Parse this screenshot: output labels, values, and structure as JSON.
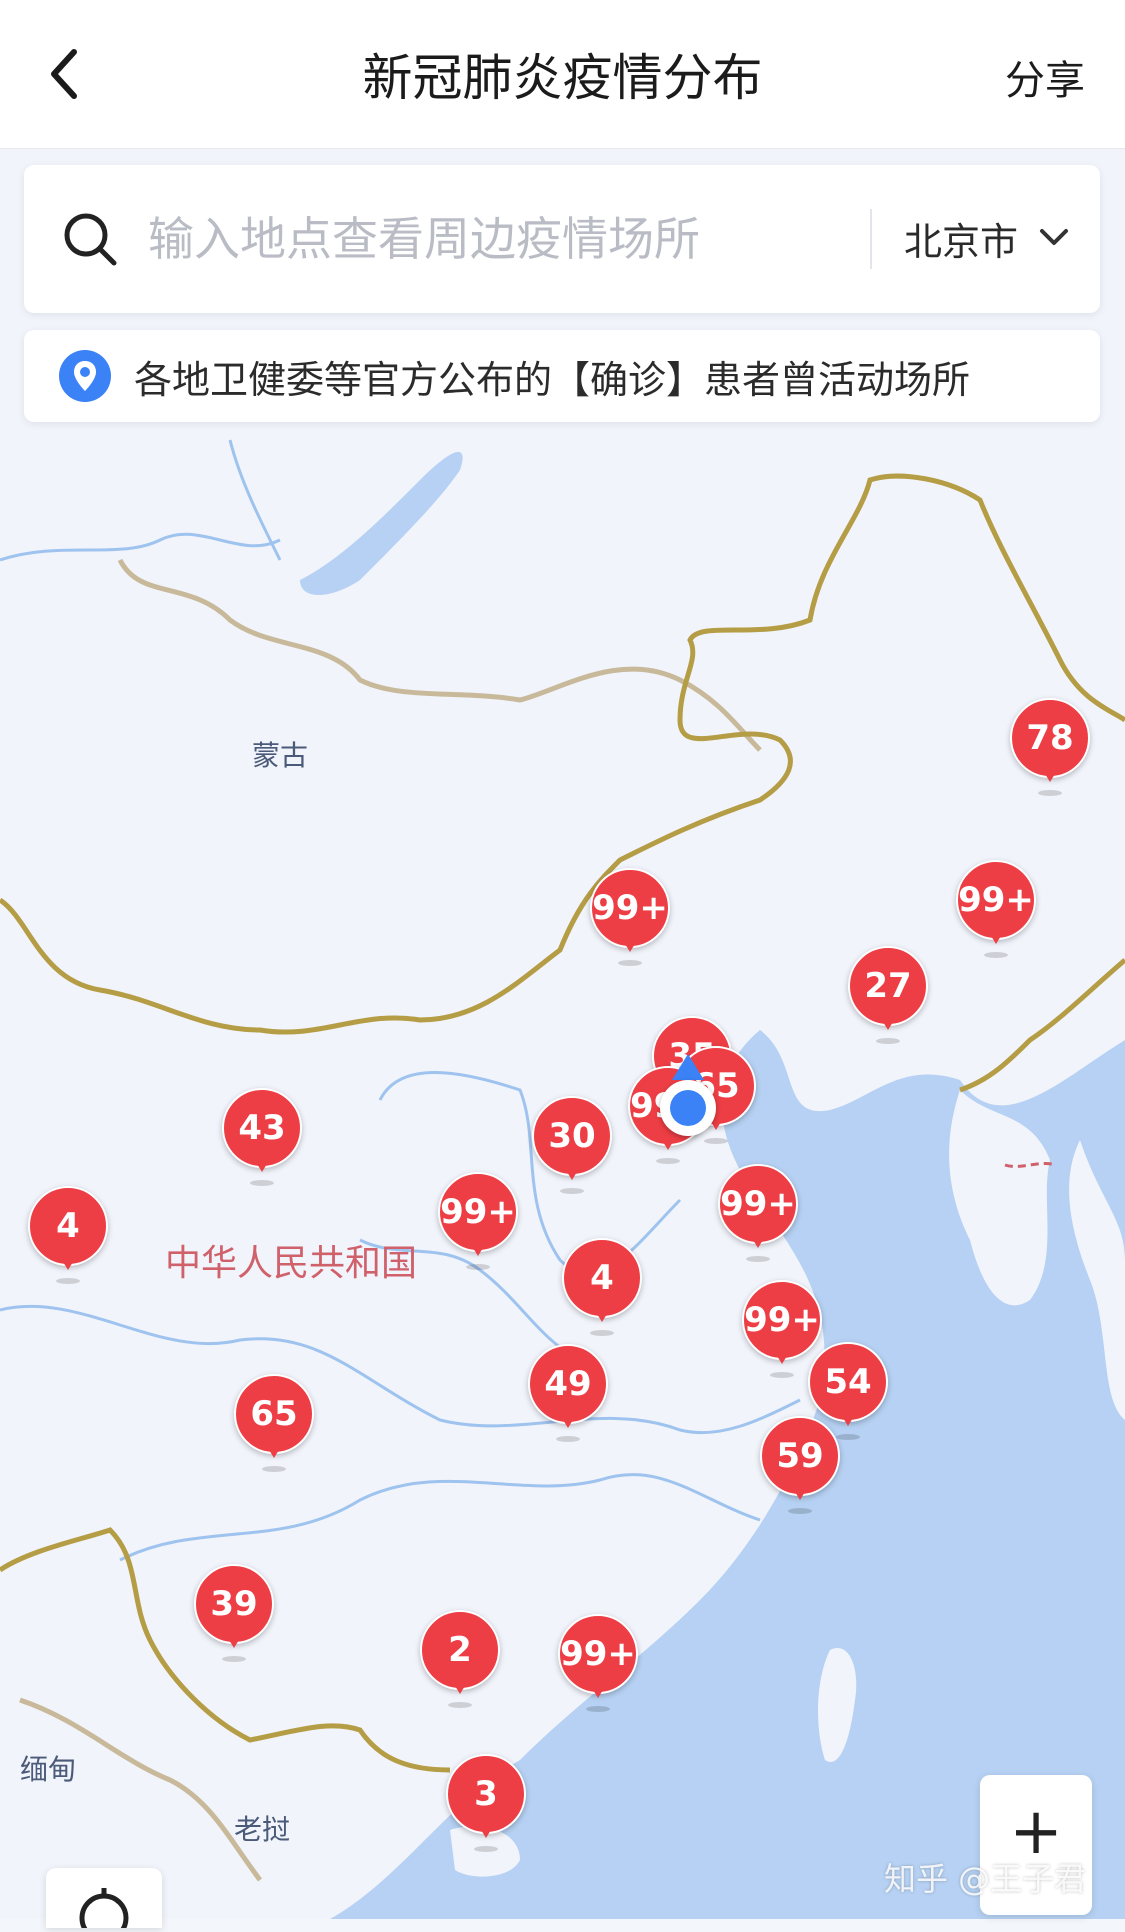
{
  "header": {
    "title": "新冠肺炎疫情分布",
    "share_label": "分享"
  },
  "search": {
    "placeholder": "输入地点查看周边疫情场所",
    "city": "北京市"
  },
  "info": {
    "text": "各地卫健委等官方公布的【确诊】患者曾活动场所"
  },
  "map_labels": {
    "mongolia": "蒙古",
    "china": "中华人民共和国",
    "myanmar": "缅甸",
    "laos": "老挝"
  },
  "markers": [
    {
      "label": "78"
    },
    {
      "label": "99+"
    },
    {
      "label": "99+"
    },
    {
      "label": "27"
    },
    {
      "label": "35"
    },
    {
      "label": "65"
    },
    {
      "label": "99+"
    },
    {
      "label": "43"
    },
    {
      "label": "30"
    },
    {
      "label": "4"
    },
    {
      "label": "99+"
    },
    {
      "label": "99+"
    },
    {
      "label": "4"
    },
    {
      "label": "99+"
    },
    {
      "label": "54"
    },
    {
      "label": "49"
    },
    {
      "label": "65"
    },
    {
      "label": "59"
    },
    {
      "label": "39"
    },
    {
      "label": "2"
    },
    {
      "label": "99+"
    },
    {
      "label": "3"
    }
  ],
  "controls": {
    "zoom_in": "+"
  },
  "watermark": "知乎 @王子君",
  "colors": {
    "marker": "#ee3e45",
    "location": "#3b82f6",
    "sea": "#b6d1f3",
    "land": "#f1f4fb",
    "border": "#b59d45"
  }
}
